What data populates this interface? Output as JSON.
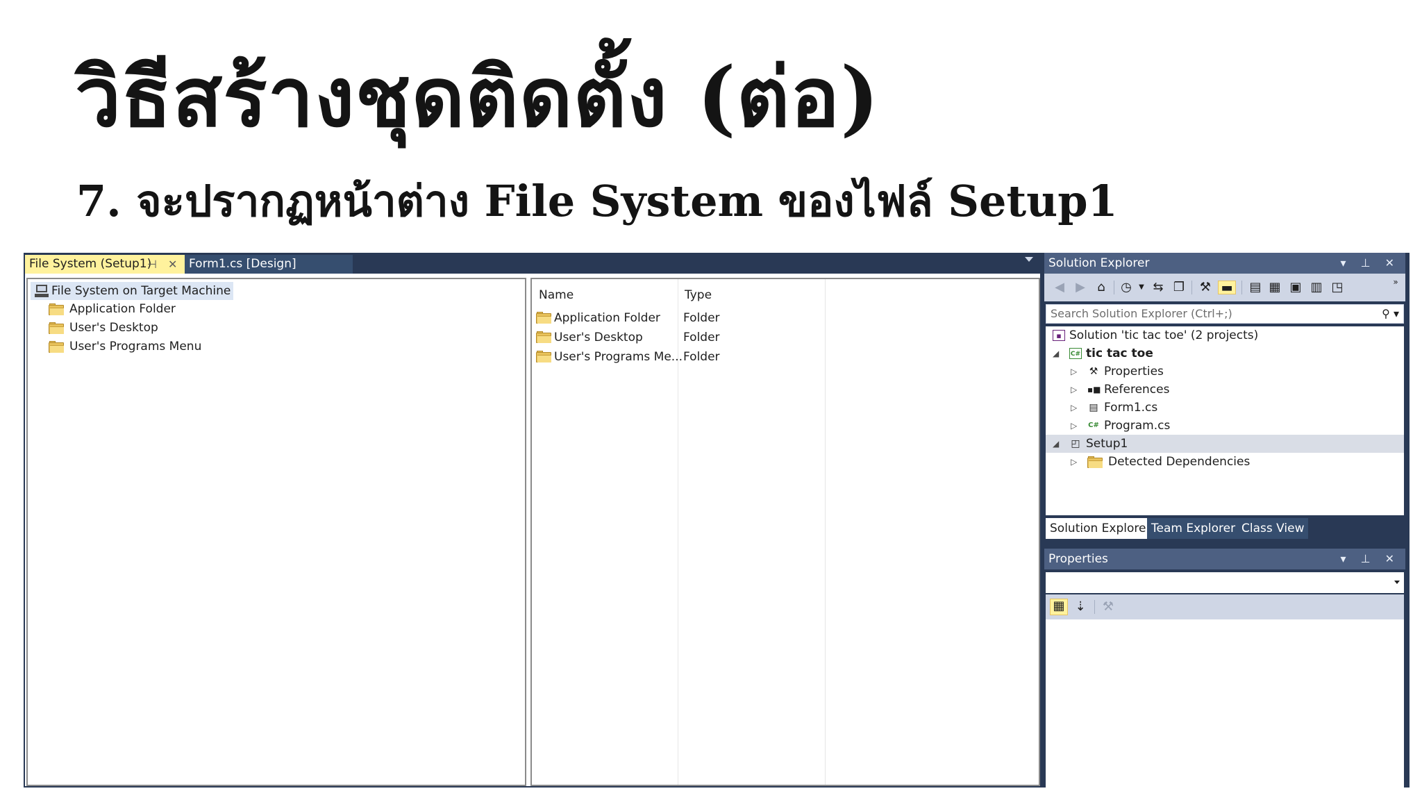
{
  "slide": {
    "title": "วิธีสร้างชุดติดตั้ง (ต่อ)",
    "subtitle": "7. จะปรากฏหน้าต่าง File System ของไฟล์ Setup1"
  },
  "document_tabs": [
    {
      "label": "File System (Setup1)",
      "pin": "⊣",
      "close": "✕"
    },
    {
      "label": "Form1.cs [Design]"
    }
  ],
  "file_system_tree": {
    "root": "File System on Target Machine",
    "children": [
      "Application Folder",
      "User's Desktop",
      "User's Programs Menu"
    ]
  },
  "file_list": {
    "columns": [
      "Name",
      "Type"
    ],
    "rows": [
      {
        "name": "Application Folder",
        "type": "Folder"
      },
      {
        "name": "User's Desktop",
        "type": "Folder"
      },
      {
        "name": "User's Programs Me...",
        "type": "Folder"
      }
    ]
  },
  "solution_explorer": {
    "title": "Solution Explorer",
    "controls": "▾ ⊥ ✕",
    "search_placeholder": "Search Solution Explorer (Ctrl+;)",
    "tree": [
      {
        "label": "Solution 'tic tac toe' (2 projects)",
        "icon": "solution-icon"
      },
      {
        "label": "tic tac toe",
        "icon": "csharp-project-icon"
      },
      {
        "label": "Properties",
        "icon": "wrench-icon"
      },
      {
        "label": "References",
        "icon": "references-icon"
      },
      {
        "label": "Form1.cs",
        "icon": "form-icon"
      },
      {
        "label": "Program.cs",
        "icon": "csharp-file-icon"
      },
      {
        "label": "Setup1",
        "icon": "setup-project-icon"
      },
      {
        "label": "Detected Dependencies",
        "icon": "folder-icon"
      }
    ],
    "bottom_tabs": [
      "Solution Explorer",
      "Team Explorer",
      "Class View"
    ]
  },
  "properties_panel": {
    "title": "Properties",
    "controls": "▾ ⊥ ✕"
  },
  "colors": {
    "ide_background": "#293955",
    "active_tab": "#fff29d",
    "panel_header": "#4d6082"
  }
}
